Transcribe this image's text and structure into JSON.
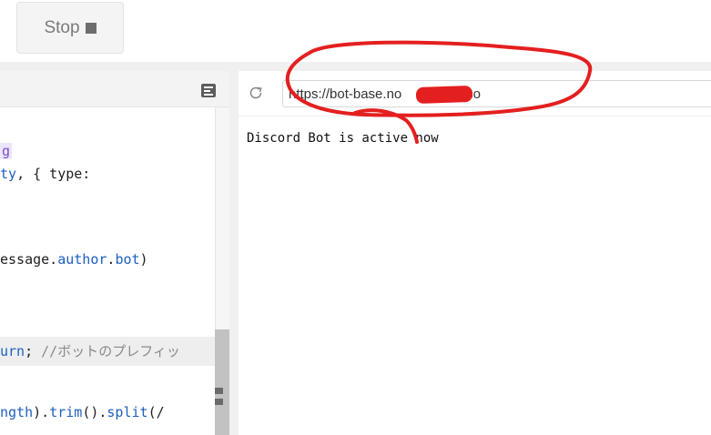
{
  "toolbar": {
    "stop_label": "Stop"
  },
  "editor": {
    "code_lines": [
      {
        "parts": [
          {
            "t": "g",
            "c": "str"
          }
        ]
      },
      {
        "parts": [
          {
            "t": "ty",
            "c": "prop"
          },
          {
            "t": ", { type:",
            "c": ""
          }
        ]
      },
      {
        "parts": [
          {
            "t": "essage.",
            "c": ""
          },
          {
            "t": "author",
            "c": "prop"
          },
          {
            "t": ".",
            "c": ""
          },
          {
            "t": "bot",
            "c": "prop"
          },
          {
            "t": ")",
            "c": ""
          }
        ]
      },
      {
        "parts": [
          {
            "t": "urn",
            "c": "kw"
          },
          {
            "t": "; ",
            "c": ""
          },
          {
            "t": "//ボットのプレフィッ",
            "c": "cmt"
          }
        ]
      },
      {
        "parts": [
          {
            "t": "ngth",
            "c": "prop"
          },
          {
            "t": ").",
            "c": ""
          },
          {
            "t": "trim",
            "c": "prop"
          },
          {
            "t": "().",
            "c": ""
          },
          {
            "t": "split",
            "c": "prop"
          },
          {
            "t": "(/",
            "c": ""
          }
        ]
      }
    ]
  },
  "preview": {
    "url": "https://bot-base.no          repl.co",
    "body_text": "Discord Bot is active now"
  },
  "colors": {
    "annotation_red": "#e41f1f",
    "link_blue": "#1d5fc0",
    "string_purple": "#7b4fc8",
    "comment_gray": "#8a8a8a"
  },
  "icons": {
    "stop": "stop-square-icon",
    "notes": "notes-icon",
    "refresh": "refresh-icon"
  }
}
